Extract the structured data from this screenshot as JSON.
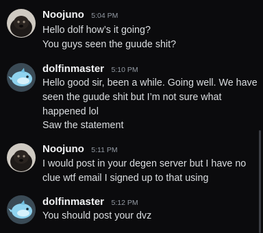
{
  "messages": [
    {
      "username": "Noojuno",
      "timestamp": "5:04 PM",
      "avatar_icon": "dog-avatar-icon",
      "lines": [
        "Hello dolf how’s it going?",
        "You guys seen the guude shit?"
      ]
    },
    {
      "username": "dolfinmaster",
      "timestamp": "5:10 PM",
      "avatar_icon": "dolphin-avatar-icon",
      "lines": [
        "Hello good sir, been a while. Going well. We have",
        "seen the guude shit but I’m not sure what",
        "happened lol",
        "Saw the statement"
      ]
    },
    {
      "username": "Noojuno",
      "timestamp": "5:11 PM",
      "avatar_icon": "dog-avatar-icon",
      "lines": [
        "I would post in your degen server but I have no",
        "clue wtf email I signed up to that using"
      ]
    },
    {
      "username": "dolfinmaster",
      "timestamp": "5:12 PM",
      "avatar_icon": "dolphin-avatar-icon",
      "lines": [
        "You should post your dvz"
      ]
    }
  ],
  "colors": {
    "background": "#0b0b0d",
    "username": "#f2f3f5",
    "timestamp": "#949ba4",
    "message_text": "#dbdee1"
  }
}
